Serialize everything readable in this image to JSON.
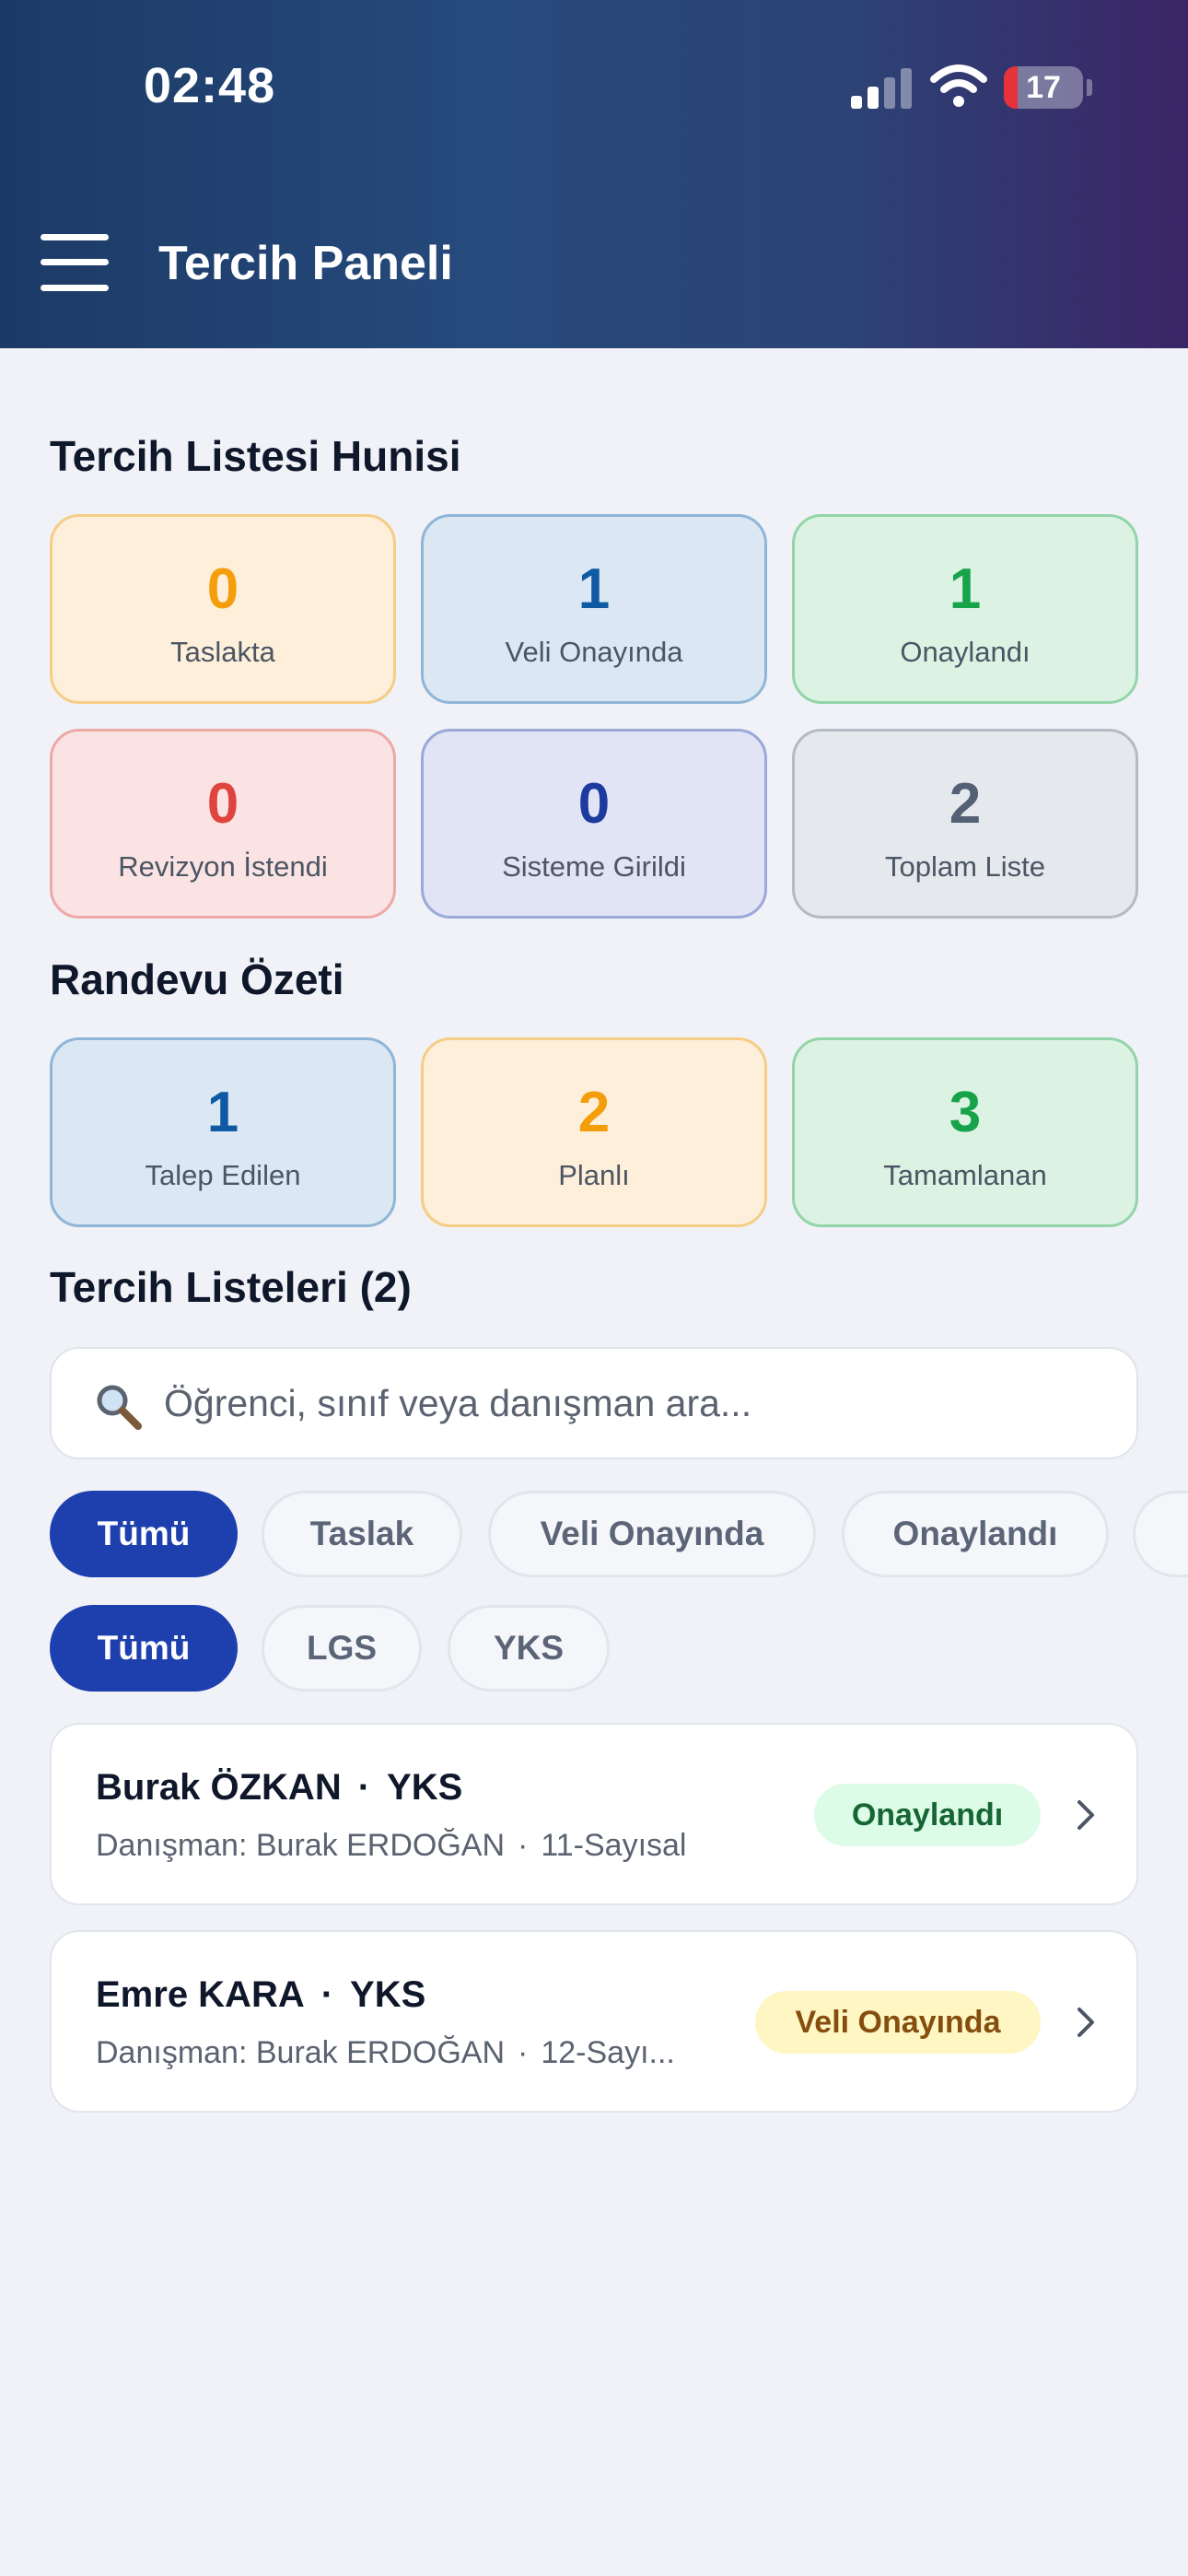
{
  "status_bar": {
    "time": "02:48",
    "battery": "17",
    "battery_level": 0.17
  },
  "header": {
    "title": "Tercih Paneli"
  },
  "funnel": {
    "title": "Tercih Listesi Hunisi",
    "cards": [
      {
        "value": "0",
        "label": "Taslakta",
        "color": "#f59e0b",
        "bg": "#fdefd9",
        "border": "#f6cd86"
      },
      {
        "value": "1",
        "label": "Veli Onayında",
        "color": "#0f5aa3",
        "bg": "#dbe8f3",
        "border": "#8fb6d8"
      },
      {
        "value": "1",
        "label": "Onaylandı",
        "color": "#16a34a",
        "bg": "#dcf2e3",
        "border": "#93d5a8"
      },
      {
        "value": "0",
        "label": "Revizyon İstendi",
        "color": "#e0443e",
        "bg": "#fbe3e3",
        "border": "#eda9a6"
      },
      {
        "value": "0",
        "label": "Sisteme Girildi",
        "color": "#1e3a9f",
        "bg": "#e0e4f4",
        "border": "#9aa9d8"
      },
      {
        "value": "2",
        "label": "Toplam Liste",
        "color": "#546175",
        "bg": "#e5e8ed",
        "border": "#b5bbc4"
      }
    ]
  },
  "appointments": {
    "title": "Randevu Özeti",
    "cards": [
      {
        "value": "1",
        "label": "Talep Edilen",
        "color": "#0f5aa3",
        "bg": "#dbe8f3",
        "border": "#8fb6d8"
      },
      {
        "value": "2",
        "label": "Planlı",
        "color": "#f59e0b",
        "bg": "#fdefd9",
        "border": "#f6cd86"
      },
      {
        "value": "3",
        "label": "Tamamlanan",
        "color": "#16a34a",
        "bg": "#dcf2e3",
        "border": "#93d5a8"
      }
    ]
  },
  "lists": {
    "title": "Tercih Listeleri (2)",
    "search_placeholder": "Öğrenci, sınıf veya danışman ara...",
    "status_filters": [
      "Tümü",
      "Taslak",
      "Veli Onayında",
      "Onaylandı"
    ],
    "exam_filters": [
      "Tümü",
      "LGS",
      "YKS"
    ],
    "active_status_filter": "Tümü",
    "active_exam_filter": "Tümü",
    "items": [
      {
        "name": "Burak ÖZKAN",
        "exam": "YKS",
        "advisor": "Danışman: Burak ERDOĞAN",
        "class": "11-Sayısal",
        "status": "Onaylandı",
        "status_bg": "#dcfce7",
        "status_color": "#166534"
      },
      {
        "name": "Emre KARA",
        "exam": "YKS",
        "advisor": "Danışman: Burak ERDOĞAN",
        "class": "12-Sayı...",
        "status": "Veli Onayında",
        "status_bg": "#fef6c3",
        "status_color": "#854d0e"
      }
    ]
  },
  "colors": {
    "primary": "#1e40af",
    "header_gradient_start": "#1c3a66",
    "header_gradient_end": "#3b2566",
    "page_bg": "#f0f2f7"
  }
}
